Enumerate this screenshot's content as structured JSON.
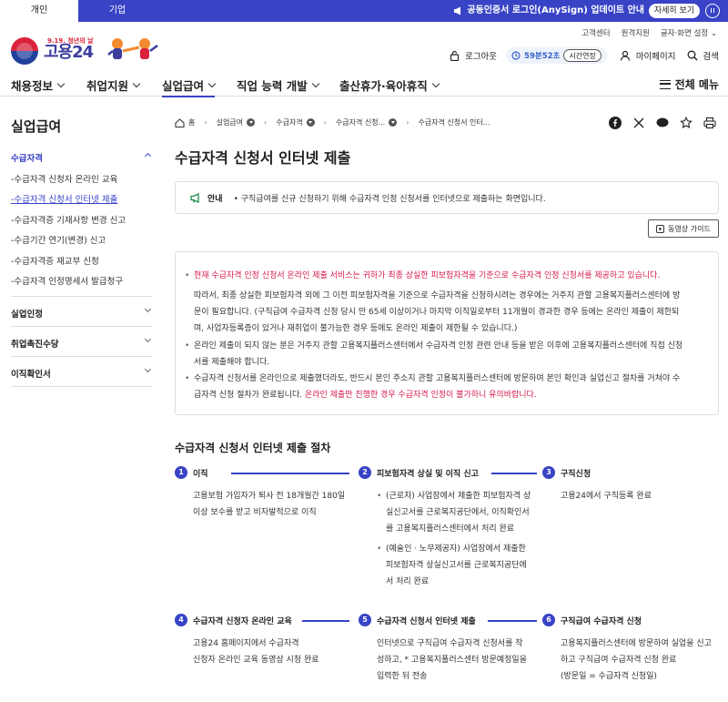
{
  "topbar": {
    "tabs": [
      "개인",
      "기업"
    ],
    "notice": "공동인증서 로그인(AnySign) 업데이트 안내",
    "notice_button": "자세히 보기"
  },
  "header": {
    "logo_small": "9.19. 청년의 날",
    "logo_text": "고용24",
    "utility": [
      "고객센터",
      "원격지원",
      "글자·화면 설정"
    ],
    "logout": "로그아웃",
    "timer": "59분52초",
    "extend": "시간연장",
    "mypage": "마이페이지",
    "search": "검색"
  },
  "gnb": {
    "items": [
      "채용정보",
      "취업지원",
      "실업급여",
      "직업 능력 개발",
      "출산휴가·육아휴직"
    ],
    "all_menu": "전체 메뉴"
  },
  "lnb": {
    "title": "실업급여",
    "section1": "수급자격",
    "subitems": [
      "-수급자격 신청자 온라인 교육",
      "-수급자격 신청서 인터넷 제출",
      "-수급자격증 기재사항 변경 신고",
      "-수급기간 연기(변경) 신고",
      "-수급자격증 재교부 신청",
      "-수급자격 인정명세서 발급청구"
    ],
    "sections": [
      "실업인정",
      "취업촉진수당",
      "이직확인서"
    ]
  },
  "breadcrumb": [
    "홈",
    "실업급여",
    "수급자격",
    "수급자격 신청...",
    "수급자격 신청서 인터..."
  ],
  "main": {
    "title": "수급자격 신청서 인터넷 제출",
    "guide_tag": "안내",
    "guide_text": "• 구직급여를 신규 신청하기 위해 수급자격 인정 신청서를 인터넷으로 제출하는 화면입니다.",
    "video_guide": "동영상 가이드",
    "info": {
      "p1_red": "현재 수급자격 인정 신청서 온라인 제출 서비스는 귀하가 최종 상실한 피보험자격을 기준으로 수급자격 인정 신청서를 제공하고 있습니다.",
      "p1_l1": "따라서, 최종 상실한 피보험자격 외에 그 이전 피보험자격을 기준으로 수급자격을 신청하시려는 경우에는 거주지 관할 고용복지플러스센터에 방",
      "p1_l2": "문이 필요합니다. (구직급여 수급자격 신청 당시 만 65세 이상이거나 마지막 이직일로부터 11개월이 경과한 경우 등에는 온라인 제출이 제한되",
      "p1_l3": "며, 사업자등록증이 있거나 재취업이 불가능한 경우 등에도 온라인 제출이 제한될 수 있습니다.)",
      "p2_l1": "온라인 제출이 되지 않는 분은 거주지 관할 고용복지플러스센터에서 수급자격 인정 관련 안내 등을 받은 이후에 고용복지플러스센터에 직접 신청",
      "p2_l2": "서를 제출해야 합니다.",
      "p3_l1": "수급자격 신청서를 온라인으로 제출했더라도, 반드시 본인 주소지 관할 고용복지플러스센터에 방문하여 본인 확인과 실업신고 절차를 거쳐야 수",
      "p3_l2a": "급자격 신청 절차가 완료됩니다. ",
      "p3_l2b": "온라인 제출만 진행한 경우 수급자격 인정이 불가하니 유의바랍니다."
    },
    "process_title": "수급자격 신청서 인터넷 제출 절차",
    "steps": [
      {
        "num": "1",
        "title": "이직",
        "lines": [
          "고용보험 가입자가 퇴사 전 18개월간 180일",
          "이상 보수를 받고 비자발적으로 이직"
        ]
      },
      {
        "num": "2",
        "title": "피보험자격 상실 및 이직 신고",
        "li1": [
          "(근로자) 사업장에서 제출한 피보험자격 상",
          "실신고서를 근로복지공단에서, 이직확인서",
          "를 고용복지플러스센터에서 처리 완료"
        ],
        "li2": [
          "(예술인 · 노무제공자) 사업장에서 제출한",
          "피보험자격 상실신고서를 근로복지공단에",
          "서 처리 완료"
        ]
      },
      {
        "num": "3",
        "title": "구직신청",
        "lines": [
          "고용24에서 구직등록 완료"
        ]
      },
      {
        "num": "4",
        "title": "수급자격 신청자 온라인 교육",
        "lines": [
          "고용24 홈페이지에서 수급자격",
          "신청자 온라인 교육 동영상 시청 완료"
        ]
      },
      {
        "num": "5",
        "title": "수급자격 신청서 인터넷 제출",
        "lines": [
          "인터넷으로 구직급여 수급자격 신청서를 작",
          "성하고, * 고용복지플러스센터 방문예정일을",
          "입력한 뒤 전송"
        ]
      },
      {
        "num": "6",
        "title": "구직급여 수급자격 신청",
        "lines": [
          "고용복지플러스센터에 방문하여 실업을 신고",
          "하고 구직급여 수급자격 신청 완료",
          "(방문일 = 수급자격 신청일)"
        ]
      }
    ]
  },
  "colors": {
    "primary": "#3843c6",
    "alert": "#d61a4a"
  }
}
